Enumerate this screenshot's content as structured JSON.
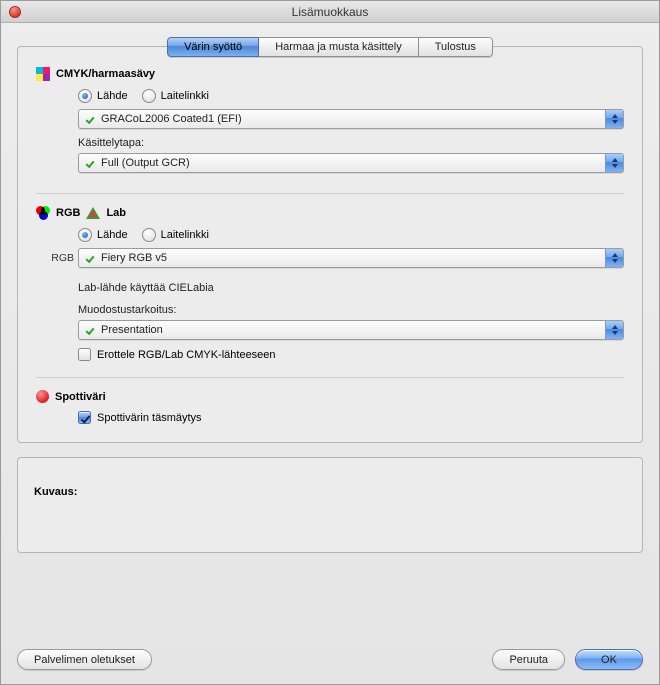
{
  "window": {
    "title": "Lisämuokkaus"
  },
  "tabs": [
    {
      "label": "Värin syöttö",
      "active": true
    },
    {
      "label": "Harmaa ja musta käsittely",
      "active": false
    },
    {
      "label": "Tulostus",
      "active": false
    }
  ],
  "cmyk": {
    "heading": "CMYK/harmaasävy",
    "radios": {
      "source": "Lähde",
      "devicelink": "Laitelinkki",
      "selected": "source"
    },
    "source_value": "GRACoL2006 Coated1 (EFI)",
    "processing_label": "Käsittelytapa:",
    "processing_value": "Full (Output GCR)"
  },
  "rgb": {
    "heading_rgb": "RGB",
    "heading_lab": "Lab",
    "sidelabel": "RGB",
    "radios": {
      "source": "Lähde",
      "devicelink": "Laitelinkki",
      "selected": "source"
    },
    "source_value": "Fiery RGB v5",
    "lab_note": "Lab-lähde käyttää CIELabia",
    "intent_label": "Muodostustarkoitus:",
    "intent_value": "Presentation",
    "separate_label": "Erottele RGB/Lab CMYK-lähteeseen",
    "separate_checked": false
  },
  "spot": {
    "heading": "Spottiväri",
    "match_label": "Spottivärin täsmäytys",
    "match_checked": true
  },
  "description": {
    "label": "Kuvaus:"
  },
  "buttons": {
    "defaults": "Palvelimen oletukset",
    "cancel": "Peruuta",
    "ok": "OK"
  }
}
